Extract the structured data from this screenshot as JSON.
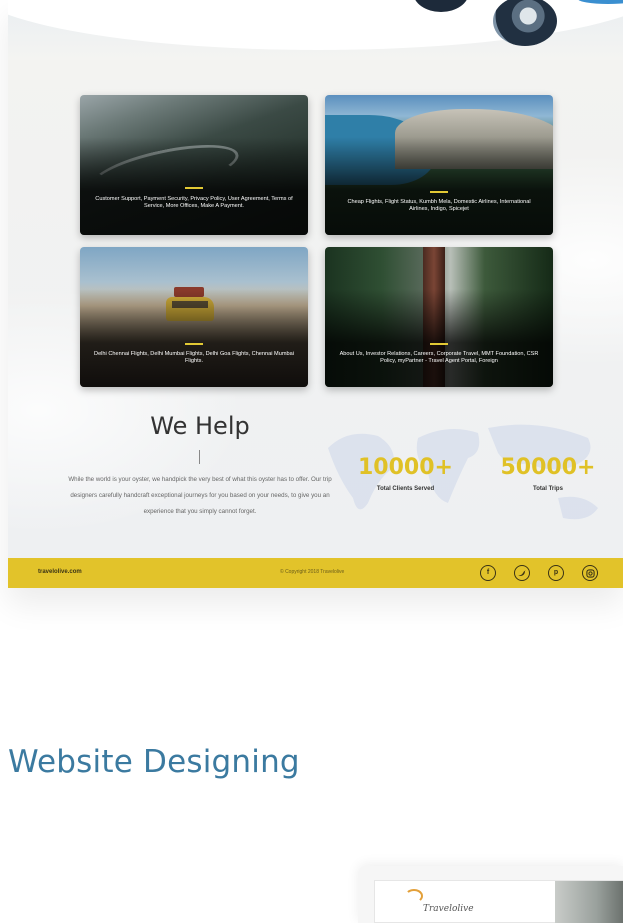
{
  "mockup": {
    "cards": [
      {
        "caption": "Customer Support, Payment Security, Privacy Policy, User Agreement, Terms of Service, More Offices, Make A Payment."
      },
      {
        "caption": "Cheap Flights, Flight Status, Kumbh Mela, Domestic Airlines, International Airlines, Indigo, Spicejet"
      },
      {
        "caption": "Delhi Chennai Flights, Delhi Mumbai Flights, Delhi Goa Flights, Chennai Mumbai Flights."
      },
      {
        "caption": "About Us, Investor Relations, Careers, Corporate Travel, MMT Foundation, CSR Policy, myPartner - Travel Agent Portal, Foreign"
      }
    ],
    "we_help": {
      "title": "We Help",
      "text": "While the world is your oyster, we handpick the very best of what this oyster has to offer. Our trip designers carefully handcraft exceptional journeys for you based on your needs, to give you an experience that you simply cannot forget."
    },
    "stats": [
      {
        "number": "10000+",
        "label": "Total Clients Served"
      },
      {
        "number": "50000+",
        "label": "Total Trips"
      }
    ],
    "footer": {
      "domain": "travelolive.com",
      "copyright": "© Copyright 2018 Travelolive",
      "social_icons": [
        "facebook-icon",
        "twitter-icon",
        "pinterest-icon",
        "instagram-icon"
      ]
    }
  },
  "section": {
    "title": "Website Designing"
  },
  "next_mockup": {
    "logo_text": "Travelolive"
  },
  "colors": {
    "accent_yellow": "#e2c32a",
    "stat_yellow": "#e0c126",
    "heading_blue": "#3b7aa0"
  }
}
